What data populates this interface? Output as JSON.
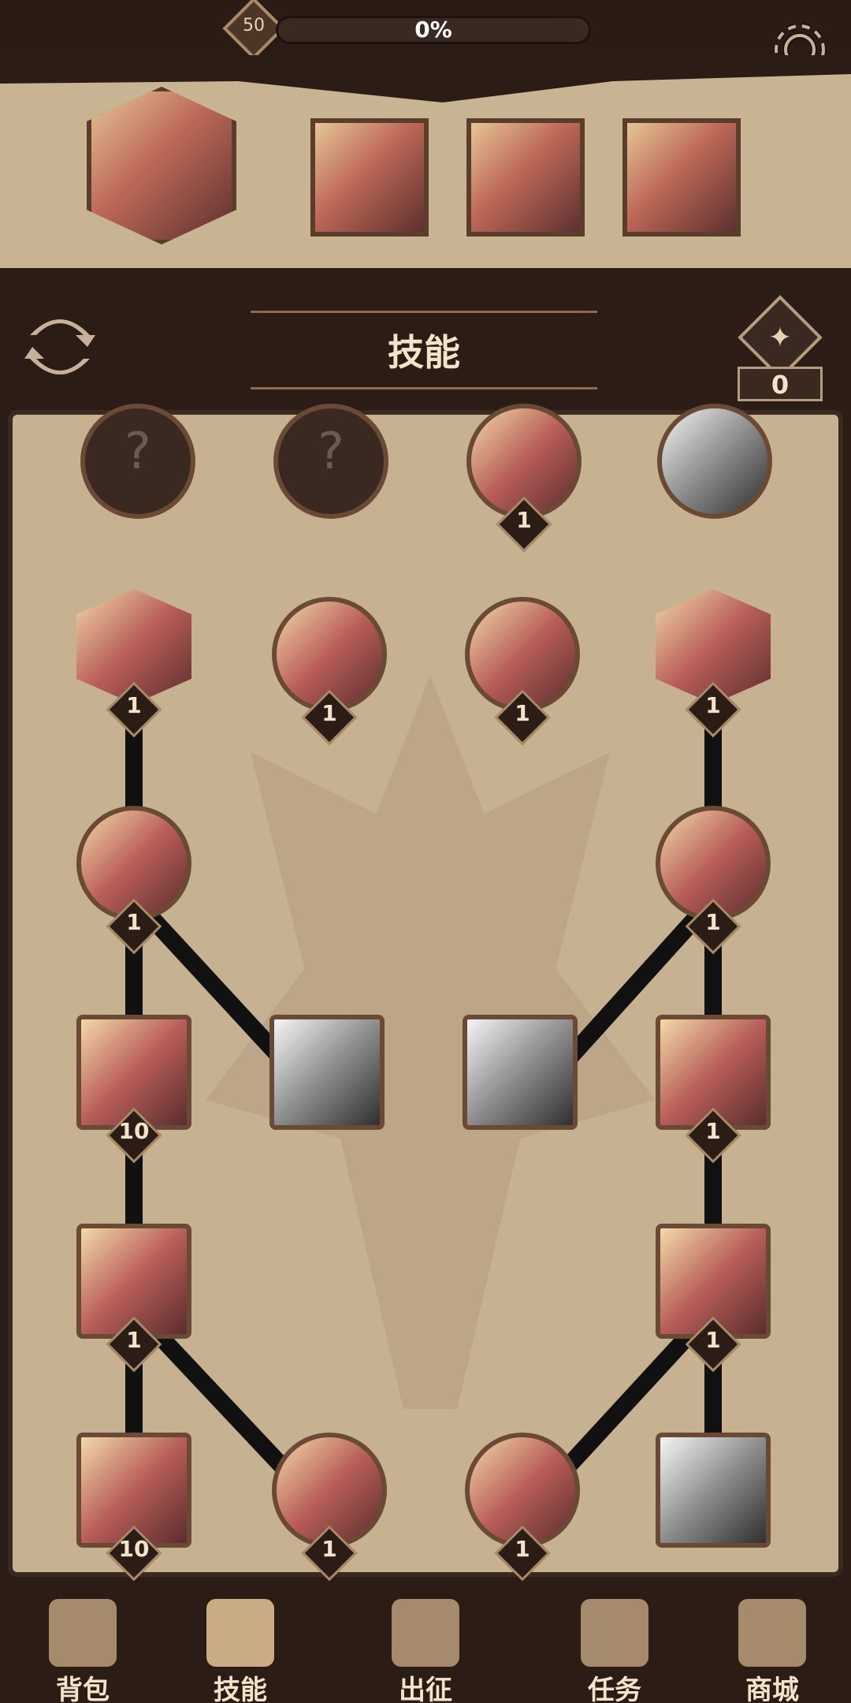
{
  "top": {
    "level": "50",
    "xp_percent": "0%"
  },
  "team": {
    "badge_count": "3"
  },
  "section": {
    "title": "技能",
    "points": "0"
  },
  "skills": {
    "row0": [
      {
        "type": "locked",
        "label": "?"
      },
      {
        "type": "locked",
        "label": "?"
      },
      {
        "type": "circle",
        "badge": "1"
      },
      {
        "type": "circle",
        "badge": ""
      }
    ],
    "row1": [
      {
        "type": "hex",
        "badge": "1"
      },
      {
        "type": "circle",
        "badge": "1"
      },
      {
        "type": "circle",
        "badge": "1"
      },
      {
        "type": "hex",
        "badge": "1"
      }
    ],
    "row2": [
      {
        "type": "circle",
        "badge": "1"
      },
      {
        "type": "circle",
        "badge": "1"
      }
    ],
    "row3": [
      {
        "type": "square",
        "badge": "10"
      },
      {
        "type": "square",
        "badge": ""
      },
      {
        "type": "square",
        "badge": ""
      },
      {
        "type": "square",
        "badge": "1"
      }
    ],
    "row4": [
      {
        "type": "square",
        "badge": "1"
      },
      {
        "type": "square",
        "badge": "1"
      }
    ],
    "row5": [
      {
        "type": "square",
        "badge": "10"
      },
      {
        "type": "circle",
        "badge": "1"
      },
      {
        "type": "circle",
        "badge": "1"
      },
      {
        "type": "square",
        "badge": ""
      }
    ]
  },
  "nav": [
    {
      "label": "背包"
    },
    {
      "label": "技能"
    },
    {
      "label": "出征"
    },
    {
      "label": "任务"
    },
    {
      "label": "商城"
    }
  ],
  "icons": {
    "settings": "gear-icon",
    "refresh": "refresh-icon",
    "points": "star-icon",
    "nav_bag": "backpack-icon",
    "nav_skill": "skill-book-icon",
    "nav_battle": "sword-icon",
    "nav_task": "horn-icon",
    "nav_shop": "shop-icon"
  },
  "colors": {
    "background": "#2b1d16",
    "paper": "#c6b191",
    "frame": "#6b4a35",
    "accent_teal": "#3a8f86"
  }
}
